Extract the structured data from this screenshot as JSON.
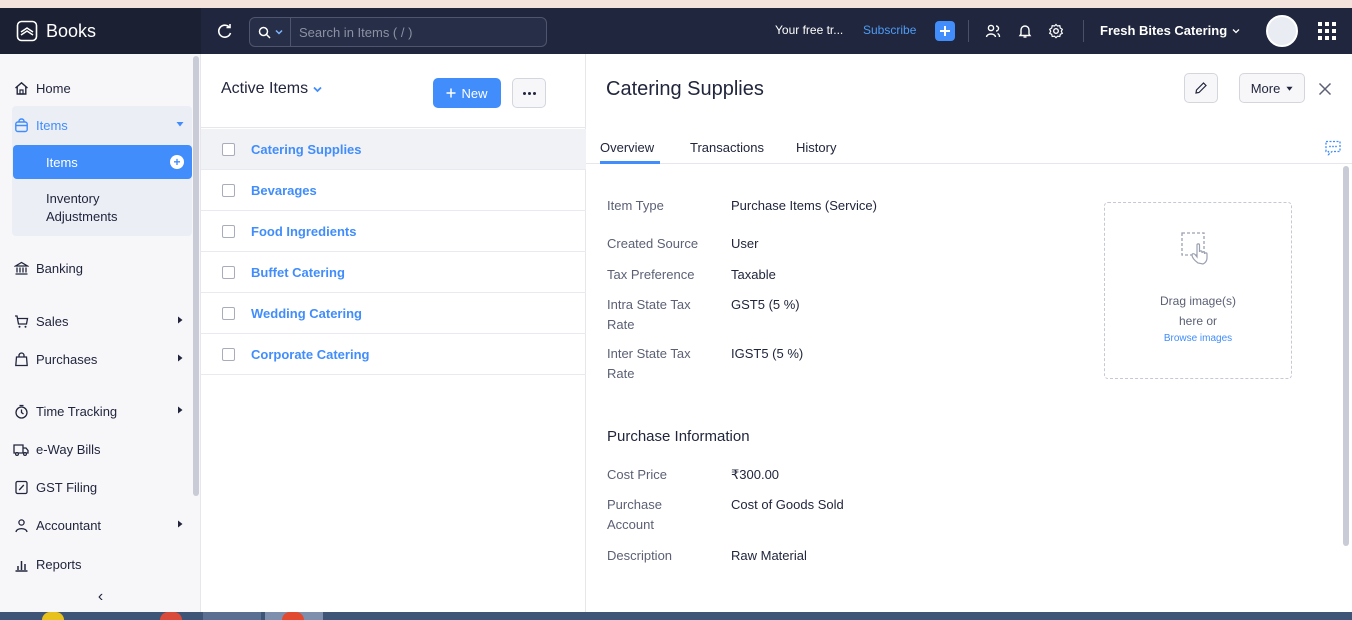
{
  "app": {
    "brand": "Books"
  },
  "header": {
    "search_placeholder": "Search in Items ( / )",
    "trial_text": "Your free tr...",
    "subscribe_label": "Subscribe",
    "org_name": "Fresh Bites Catering"
  },
  "sidebar": {
    "home": "Home",
    "items_group": "Items",
    "items_active": "Items",
    "inventory_adjust_line1": "Inventory",
    "inventory_adjust_line2": "Adjustments",
    "banking": "Banking",
    "sales": "Sales",
    "purchases": "Purchases",
    "time_tracking": "Time Tracking",
    "eway": "e-Way Bills",
    "gst": "GST Filing",
    "accountant": "Accountant",
    "reports": "Reports",
    "collapse_glyph": "‹"
  },
  "list": {
    "title": "Active Items",
    "new_label": "New",
    "rows": [
      {
        "name": "Catering Supplies"
      },
      {
        "name": "Bevarages"
      },
      {
        "name": "Food Ingredients"
      },
      {
        "name": "Buffet Catering"
      },
      {
        "name": "Wedding Catering"
      },
      {
        "name": "Corporate Catering"
      }
    ]
  },
  "detail": {
    "title": "Catering Supplies",
    "more_label": "More",
    "tabs": [
      "Overview",
      "Transactions",
      "History"
    ],
    "fields": {
      "item_type_label": "Item Type",
      "item_type_value": "Purchase Items (Service)",
      "created_source_label": "Created Source",
      "created_source_value": "User",
      "tax_pref_label": "Tax Preference",
      "tax_pref_value": "Taxable",
      "intra_label_1": "Intra State Tax",
      "intra_label_2": "Rate",
      "intra_value": "GST5 (5 %)",
      "inter_label_1": "Inter State Tax",
      "inter_label_2": "Rate",
      "inter_value": "IGST5 (5 %)"
    },
    "purchase": {
      "section_title": "Purchase Information",
      "cost_label": "Cost Price",
      "cost_value": "₹300.00",
      "account_label_1": "Purchase",
      "account_label_2": "Account",
      "account_value": "Cost of Goods Sold",
      "desc_label": "Description",
      "desc_value": "Raw Material"
    },
    "dropzone": {
      "line1": "Drag image(s)",
      "line2": "here or",
      "link": "Browse images"
    }
  },
  "colors": {
    "accent": "#408dfb",
    "header_bg": "#20263d",
    "sidebar_bg": "#f7f7fa"
  }
}
